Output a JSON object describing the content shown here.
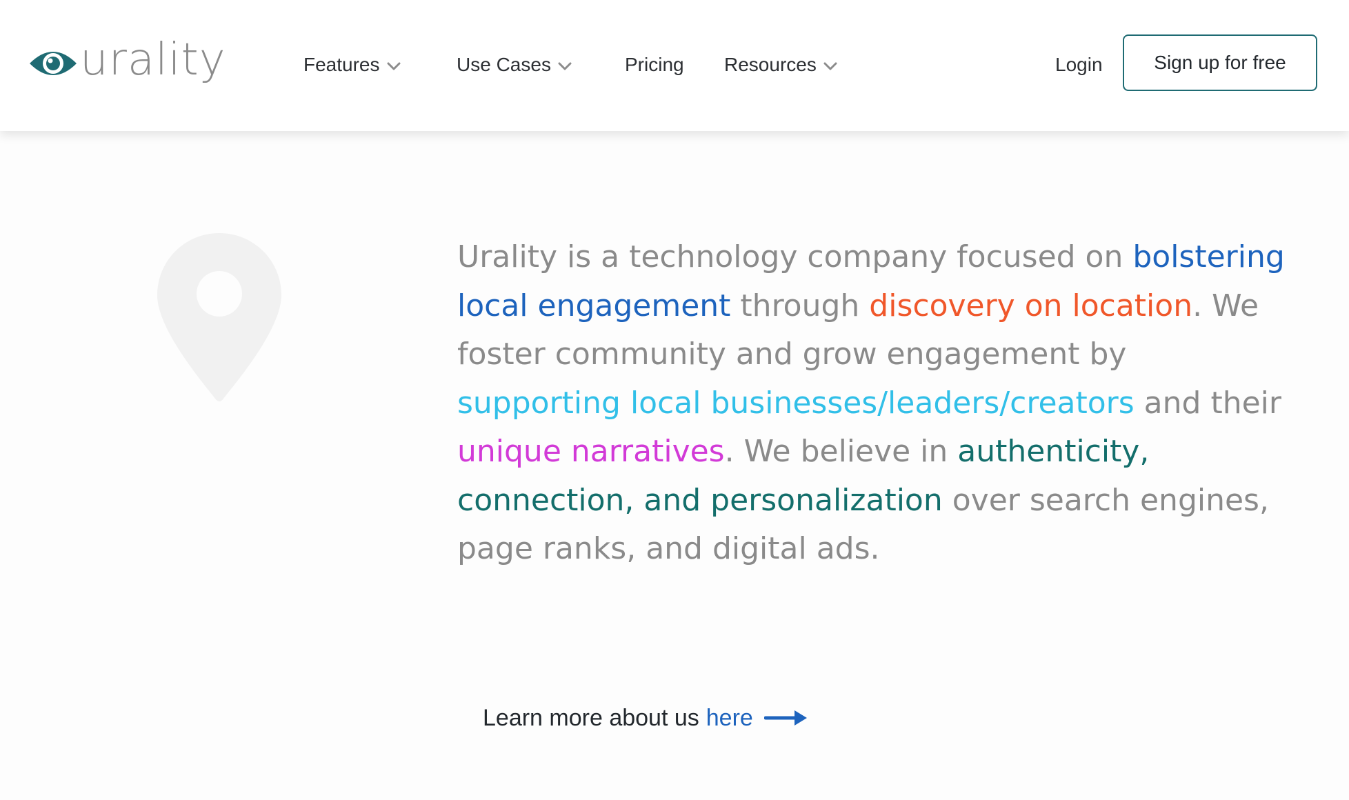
{
  "brand": {
    "name": "urality",
    "accent": "#1f6b73",
    "mark_icon": "eye-icon"
  },
  "nav": {
    "items": [
      {
        "label": "Features",
        "has_dropdown": true
      },
      {
        "label": "Use Cases",
        "has_dropdown": true
      },
      {
        "label": "Pricing",
        "has_dropdown": false
      },
      {
        "label": "Resources",
        "has_dropdown": true
      }
    ],
    "dropdown_icon": "chevron-down-icon",
    "login_label": "Login",
    "signup_label": "Sign up for free"
  },
  "hero": {
    "icon": "location-pin-icon",
    "about_segments": [
      {
        "text": "Urality is a technology company focused on ",
        "color": "#8a8a8a"
      },
      {
        "text": "bolstering local engagement",
        "color": "#1d63bd"
      },
      {
        "text": " through ",
        "color": "#8a8a8a"
      },
      {
        "text": "discovery on location",
        "color": "#f0572a"
      },
      {
        "text": ". We foster community and grow engagement by ",
        "color": "#8a8a8a"
      },
      {
        "text": "supporting local businesses/leaders/creators",
        "color": "#31bfe8"
      },
      {
        "text": " and their ",
        "color": "#8a8a8a"
      },
      {
        "text": "unique narratives",
        "color": "#d23ad7"
      },
      {
        "text": ". We believe in ",
        "color": "#8a8a8a"
      },
      {
        "text": "authenticity, connection, and personalization",
        "color": "#136e6b"
      },
      {
        "text": " over search engines, page ranks, and digital ads.",
        "color": "#8a8a8a"
      }
    ],
    "learn_more_text": "Learn more about us",
    "learn_more_link": "here",
    "arrow_icon": "arrow-right-icon"
  }
}
